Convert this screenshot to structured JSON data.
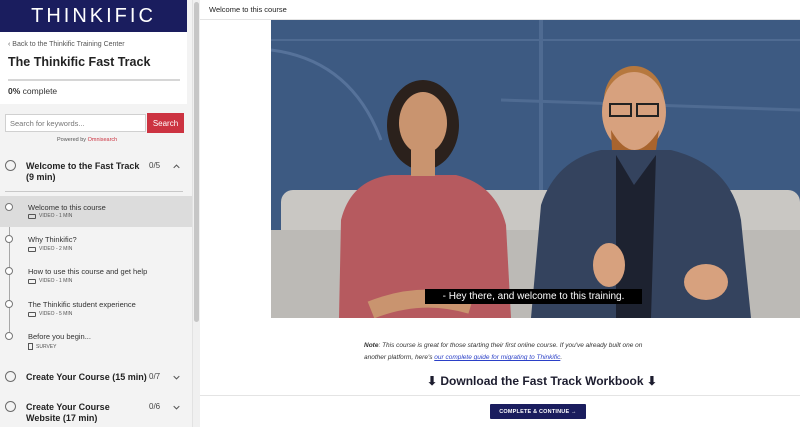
{
  "brand": {
    "logo_text": "THINKIFIC"
  },
  "sidebar": {
    "back_link": "‹ Back to the Thinkific Training Center",
    "course_title": "The Thinkific Fast Track",
    "progress_value": "0%",
    "progress_label": "complete",
    "progress_fraction": 0,
    "search": {
      "placeholder": "Search for keywords...",
      "button": "Search"
    },
    "powered_by": "Powered by",
    "powered_brand": "Omnisearch",
    "chapters": [
      {
        "title_line1": "Welcome to the Fast Track",
        "title_line2": "(9 min)",
        "count": "0/5",
        "expanded": true
      },
      {
        "title_line1": "Create Your Course (15 min)",
        "title_line2": "",
        "count": "0/7",
        "expanded": false
      },
      {
        "title_line1": "Create Your Course",
        "title_line2": "Website (17 min)",
        "count": "0/6",
        "expanded": false
      }
    ],
    "lessons": [
      {
        "title": "Welcome to this course",
        "meta": "VIDEO - 1 MIN",
        "icon": "video-icon"
      },
      {
        "title": "Why Thinkific?",
        "meta": "VIDEO - 2 MIN",
        "icon": "video-icon"
      },
      {
        "title": "How to use this course and get help",
        "meta": "VIDEO - 1 MIN",
        "icon": "video-icon"
      },
      {
        "title": "The Thinkific student experience",
        "meta": "VIDEO - 5 MIN",
        "icon": "video-icon"
      },
      {
        "title": "Before you begin...",
        "meta": "SURVEY",
        "icon": "survey-icon"
      }
    ]
  },
  "main": {
    "lesson_title": "Welcome to this course",
    "video_caption": "- Hey there, and welcome to this training.",
    "note_label": "Note",
    "note_text": ": This course is great for those starting their first online course. If you've already built one on another platform, here's ",
    "note_link": "our complete guide for migrating to Thinkific",
    "note_end": ".",
    "download_text": "⬇ Download the Fast Track Workbook ⬇",
    "complete_button": "COMPLETE & CONTINUE →"
  },
  "colors": {
    "brand_navy": "#1a1d5e",
    "search_red": "#cc3341",
    "link_blue": "#2b40c7"
  }
}
